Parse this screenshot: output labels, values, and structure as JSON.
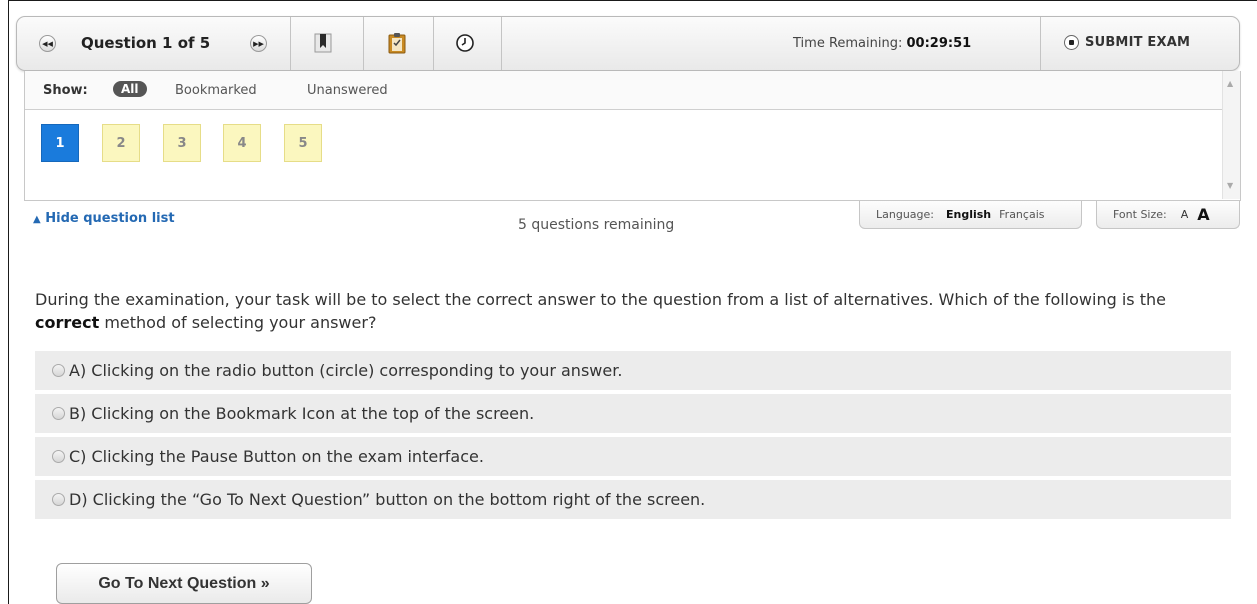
{
  "toolbar": {
    "prev_icon": "rewind-icon",
    "question_title": "Question 1 of 5",
    "next_icon": "fast-forward-icon",
    "bookmark_icon": "bookmark-icon",
    "clipboard_icon": "clipboard-icon",
    "clock_icon": "clock-icon",
    "time_label": "Time Remaining:",
    "time_value": "00:29:51",
    "submit_label": "SUBMIT EXAM"
  },
  "question_list": {
    "show_label": "Show:",
    "filters": [
      "All",
      "Bookmarked",
      "Unanswered"
    ],
    "active_filter": "All",
    "questions": [
      "1",
      "2",
      "3",
      "4",
      "5"
    ],
    "current": "1"
  },
  "status": {
    "hide_link": "Hide question list",
    "remaining": "5 questions remaining",
    "language_label": "Language:",
    "language_selected": "English",
    "language_alt": "Français",
    "font_size_label": "Font Size:",
    "font_small": "A",
    "font_large": "A"
  },
  "question": {
    "text_before": "During the examination, your task will be to select the correct answer to the question from a list of alternatives. Which of the following is the ",
    "text_bold": "correct",
    "text_after": " method of selecting your answer?",
    "options": [
      "A) Clicking on the radio button (circle) corresponding to your answer.",
      "B) Clicking on the Bookmark Icon at the top of the screen.",
      "C) Clicking the Pause Button on the exam interface.",
      "D) Clicking the “Go To Next Question” button on the bottom right of the screen."
    ]
  },
  "footer": {
    "next_button": "Go To Next Question »"
  },
  "colors": {
    "active_question": "#1a7bdc",
    "unanswered_question": "#fbf7bf",
    "link": "#2469b3",
    "option_bg": "#ececec"
  }
}
